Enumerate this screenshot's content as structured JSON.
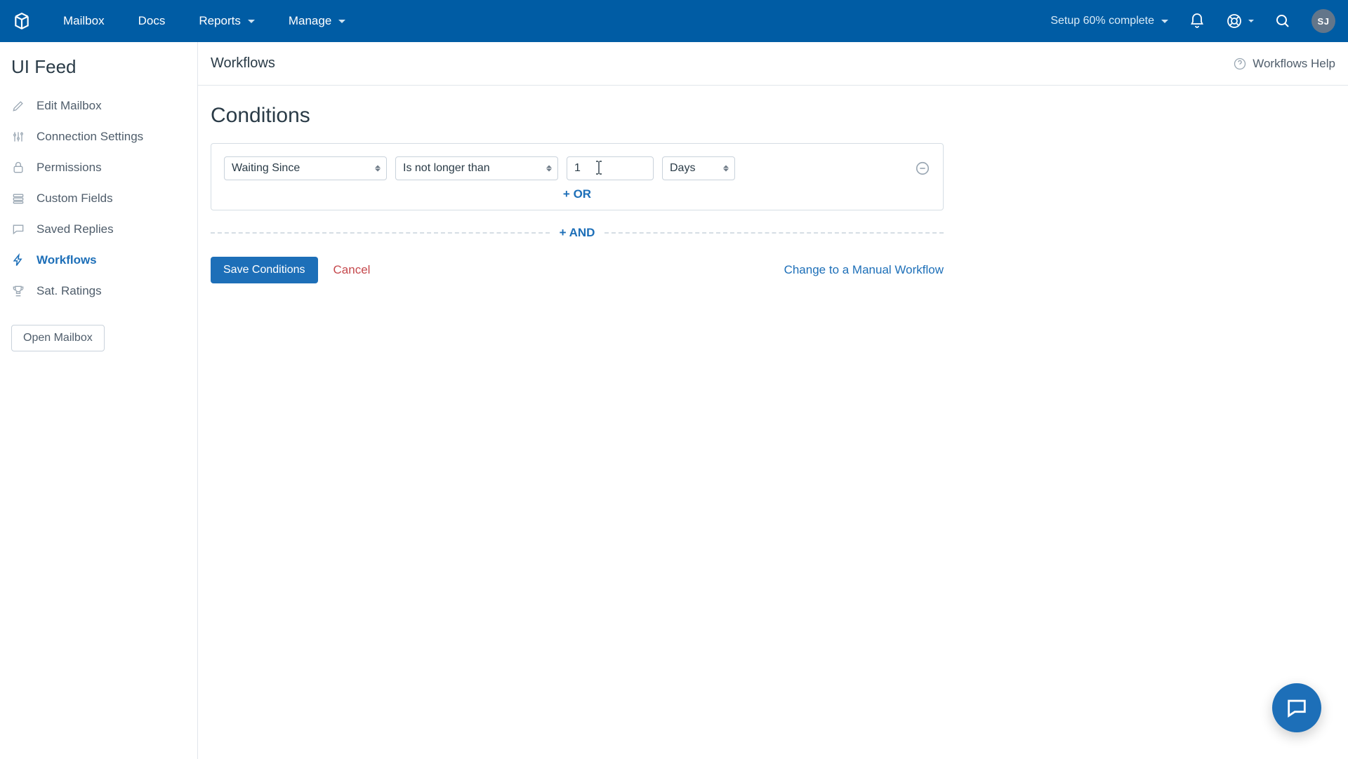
{
  "topnav": {
    "links": [
      "Mailbox",
      "Docs",
      "Reports",
      "Manage"
    ],
    "setup_text": "Setup 60% complete",
    "avatar_initials": "SJ"
  },
  "sidebar": {
    "title": "UI Feed",
    "items": [
      {
        "label": "Edit Mailbox"
      },
      {
        "label": "Connection Settings"
      },
      {
        "label": "Permissions"
      },
      {
        "label": "Custom Fields"
      },
      {
        "label": "Saved Replies"
      },
      {
        "label": "Workflows"
      },
      {
        "label": "Sat. Ratings"
      }
    ],
    "open_mailbox": "Open Mailbox"
  },
  "main": {
    "header_title": "Workflows",
    "help_link": "Workflows Help",
    "section_title": "Conditions",
    "condition": {
      "field_select": "Waiting Since",
      "operator_select": "Is not longer than",
      "value": "1",
      "unit_select": "Days"
    },
    "or_link": "+ OR",
    "and_link": "+ AND",
    "save_btn": "Save Conditions",
    "cancel_link": "Cancel",
    "manual_link": "Change to a Manual Workflow"
  },
  "colors": {
    "brand_blue": "#005ca4",
    "link_blue": "#1d6fb8",
    "danger": "#c5484c"
  }
}
